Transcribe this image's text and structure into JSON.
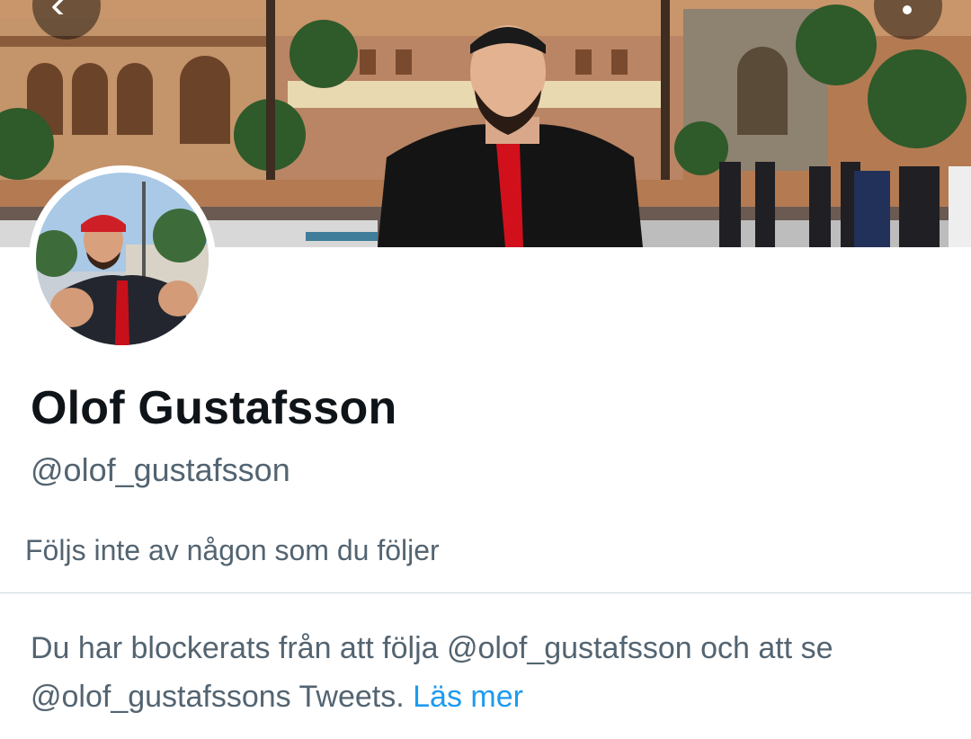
{
  "profile": {
    "display_name": "Olof Gustafsson",
    "handle": "@olof_gustafsson",
    "followed_by_text": "Följs inte av någon som du följer"
  },
  "blocked_notice": {
    "text": "Du har blockerats från att följa @olof_gustafsson och att se @olof_gustafssons Tweets.",
    "learn_more_label": "Läs mer"
  },
  "icons": {
    "back": "arrow-left-icon",
    "more": "more-icon"
  },
  "colors": {
    "text_primary": "#0f1419",
    "text_secondary": "#536471",
    "link": "#1d9bf0",
    "divider": "#cfd9de"
  }
}
